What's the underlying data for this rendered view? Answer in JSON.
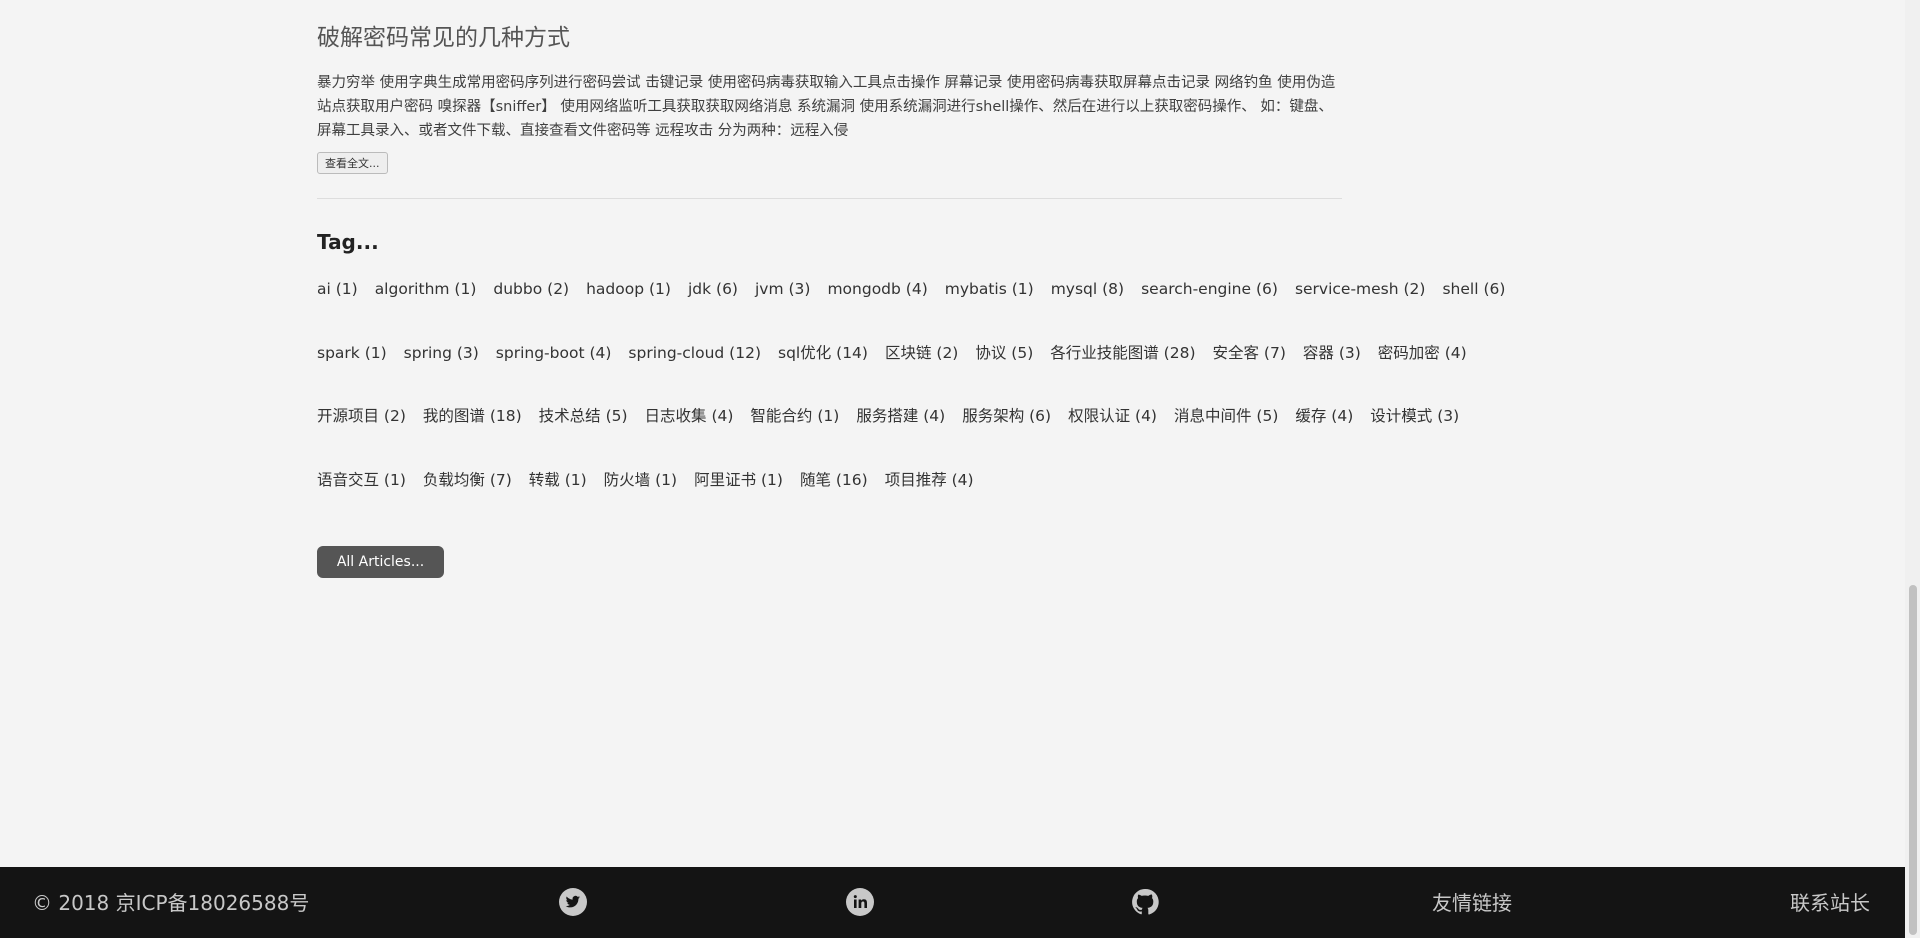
{
  "article": {
    "title": "破解密码常见的几种方式",
    "excerpt": "暴力穷举 使用字典生成常用密码序列进行密码尝试 击键记录 使用密码病毒获取输入工具点击操作 屏幕记录 使用密码病毒获取屏幕点击记录 网络钓鱼 使用伪造站点获取用户密码 嗅探器【sniffer】 使用网络监听工具获取获取网络消息 系统漏洞 使用系统漏洞进行shell操作、然后在进行以上获取密码操作、 如：键盘、屏幕工具录入、或者文件下载、直接查看文件密码等 远程攻击 分为两种：远程入侵",
    "read_more_label": "查看全文..."
  },
  "tags": {
    "heading": "Tag...",
    "rows": [
      [
        {
          "name": "ai",
          "count": "(1)"
        },
        {
          "name": "algorithm",
          "count": "(1)"
        },
        {
          "name": "dubbo",
          "count": "(2)"
        },
        {
          "name": "hadoop",
          "count": "(1)"
        },
        {
          "name": "jdk",
          "count": "(6)"
        },
        {
          "name": "jvm",
          "count": "(3)"
        },
        {
          "name": "mongodb",
          "count": "(4)"
        },
        {
          "name": "mybatis",
          "count": "(1)"
        },
        {
          "name": "mysql",
          "count": "(8)"
        },
        {
          "name": "search-engine",
          "count": "(6)"
        },
        {
          "name": "service-mesh",
          "count": "(2)"
        },
        {
          "name": "shell",
          "count": "(6)"
        }
      ],
      [
        {
          "name": "spark",
          "count": "(1)"
        },
        {
          "name": "spring",
          "count": "(3)"
        },
        {
          "name": "spring-boot",
          "count": "(4)"
        },
        {
          "name": "spring-cloud",
          "count": "(12)"
        },
        {
          "name": "sql优化",
          "count": "(14)"
        },
        {
          "name": "区块链",
          "count": "(2)"
        },
        {
          "name": "协议",
          "count": "(5)"
        },
        {
          "name": "各行业技能图谱",
          "count": "(28)"
        },
        {
          "name": "安全客",
          "count": "(7)"
        },
        {
          "name": "容器",
          "count": "(3)"
        },
        {
          "name": "密码加密",
          "count": "(4)"
        }
      ],
      [
        {
          "name": "开源项目",
          "count": "(2)"
        },
        {
          "name": "我的图谱",
          "count": "(18)"
        },
        {
          "name": "技术总结",
          "count": "(5)"
        },
        {
          "name": "日志收集",
          "count": "(4)"
        },
        {
          "name": "智能合约",
          "count": "(1)"
        },
        {
          "name": "服务搭建",
          "count": "(4)"
        },
        {
          "name": "服务架构",
          "count": "(6)"
        },
        {
          "name": "权限认证",
          "count": "(4)"
        },
        {
          "name": "消息中间件",
          "count": "(5)"
        },
        {
          "name": "缓存",
          "count": "(4)"
        },
        {
          "name": "设计模式",
          "count": "(3)"
        }
      ],
      [
        {
          "name": "语音交互",
          "count": "(1)"
        },
        {
          "name": "负载均衡",
          "count": "(7)"
        },
        {
          "name": "转载",
          "count": "(1)"
        },
        {
          "name": "防火墙",
          "count": "(1)"
        },
        {
          "name": "阿里证书",
          "count": "(1)"
        },
        {
          "name": "随笔",
          "count": "(16)"
        },
        {
          "name": "项目推荐",
          "count": "(4)"
        }
      ]
    ]
  },
  "all_articles_label": "All Articles...",
  "footer": {
    "copyright": "© 2018 京ICP备18026588号",
    "social": [
      {
        "icon": "twitter-icon"
      },
      {
        "icon": "linkedin-icon"
      },
      {
        "icon": "github-icon"
      }
    ],
    "friend_links_label": "友情链接",
    "contact_label": "联系站长",
    "background": "#141414",
    "text_color": "#c8c8c8"
  }
}
